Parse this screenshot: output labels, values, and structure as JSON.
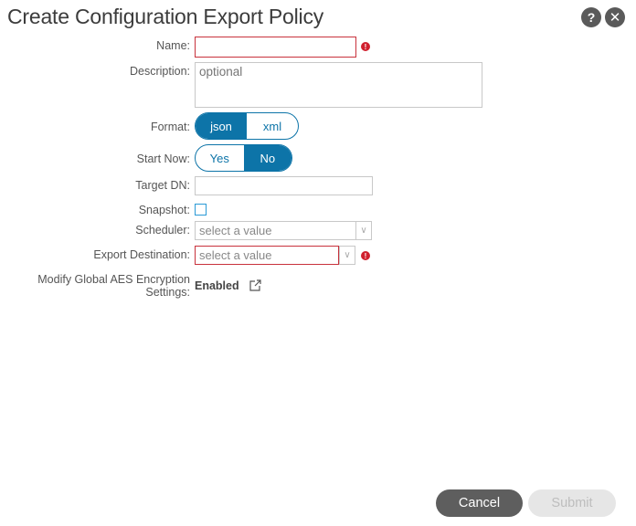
{
  "header": {
    "title": "Create Configuration Export Policy",
    "help_label": "?",
    "close_label": "✕"
  },
  "form": {
    "name": {
      "label": "Name:",
      "value": "",
      "required": true
    },
    "description": {
      "label": "Description:",
      "placeholder": "optional",
      "value": ""
    },
    "format": {
      "label": "Format:",
      "options": [
        "json",
        "xml"
      ],
      "selected": "json"
    },
    "start_now": {
      "label": "Start Now:",
      "options": [
        "Yes",
        "No"
      ],
      "selected": "No"
    },
    "target_dn": {
      "label": "Target DN:",
      "value": ""
    },
    "snapshot": {
      "label": "Snapshot:",
      "checked": false
    },
    "scheduler": {
      "label": "Scheduler:",
      "placeholder": "select a value"
    },
    "export_destination": {
      "label": "Export Destination:",
      "placeholder": "select a value",
      "required": true
    },
    "aes": {
      "label_line1": "Modify Global AES Encryption",
      "label_line2": "Settings:",
      "value": "Enabled"
    },
    "error_glyph": "!"
  },
  "footer": {
    "cancel_label": "Cancel",
    "submit_label": "Submit"
  },
  "colors": {
    "accent": "#0d74a8",
    "error": "#d0202e",
    "cancel_bg": "#5e5e5e",
    "submit_disabled_bg": "#e6e6e6"
  }
}
